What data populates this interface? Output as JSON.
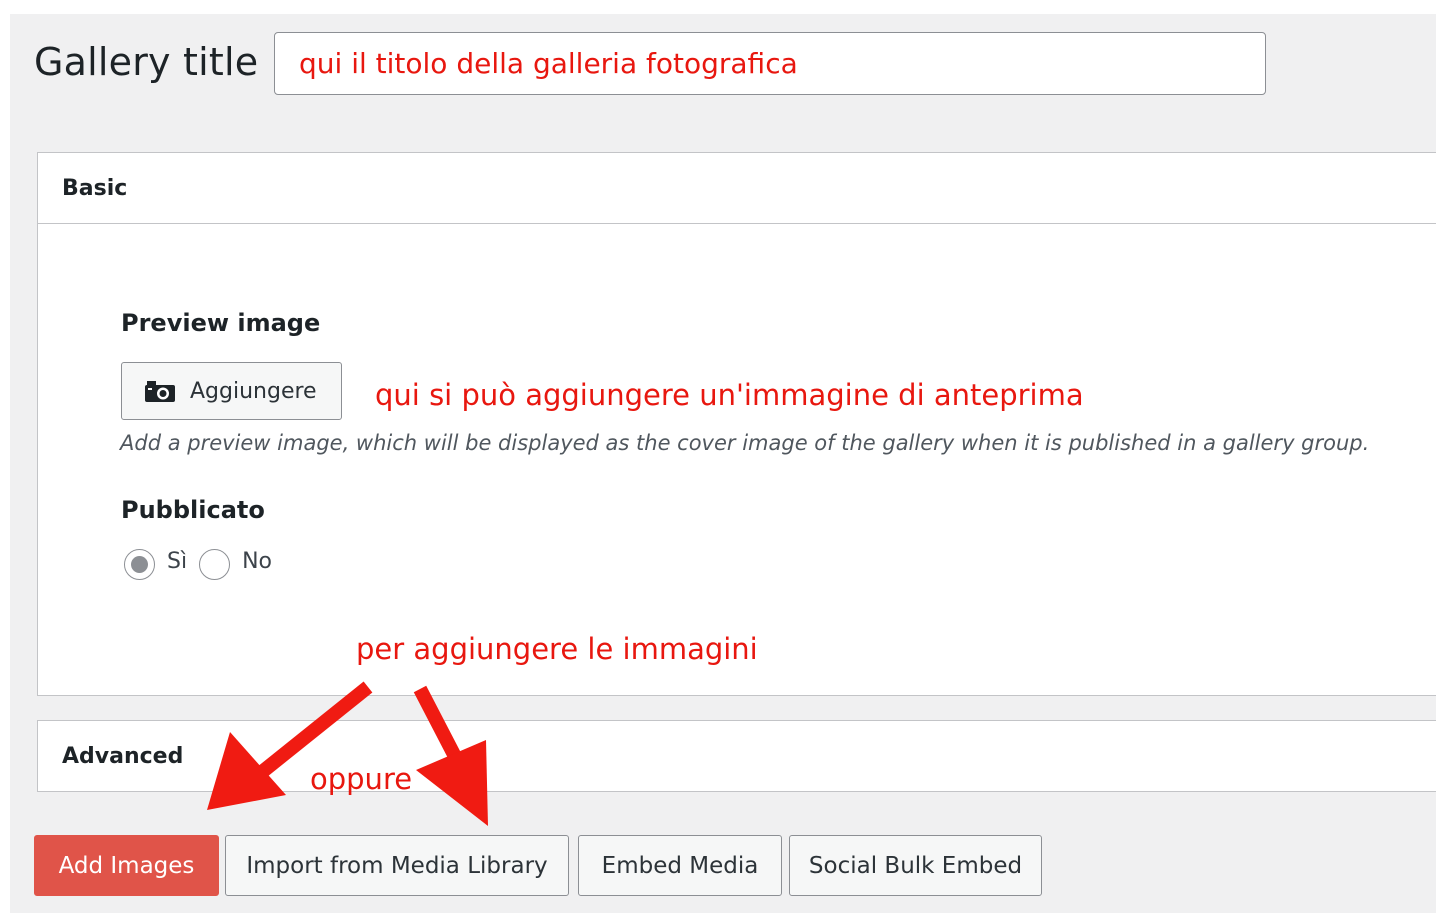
{
  "gallery": {
    "title_label": "Gallery title",
    "title_value": "qui il titolo della galleria fotografica"
  },
  "basic_panel": {
    "header": "Basic",
    "preview_label": "Preview image",
    "add_button_label": "Aggiungere",
    "add_button_icon": "camera-icon",
    "preview_annotation": "qui si può aggiungere un'immagine di anteprima",
    "preview_description": "Add a preview image, which will be displayed as the cover image of the gallery when it is published in a gallery group.",
    "published_label": "Pubblicato",
    "radio_yes": "Sì",
    "radio_no": "No",
    "selected": "Sì"
  },
  "advanced_panel": {
    "header": "Advanced"
  },
  "annotations": {
    "add_images": "per aggiungere le immagini",
    "or": "oppure"
  },
  "actions": {
    "add_images": "Add Images",
    "import_media": "Import from Media Library",
    "embed_media": "Embed Media",
    "social_bulk": "Social Bulk Embed"
  },
  "colors": {
    "annotation_red": "#e8170f",
    "primary_button": "#e05449"
  }
}
